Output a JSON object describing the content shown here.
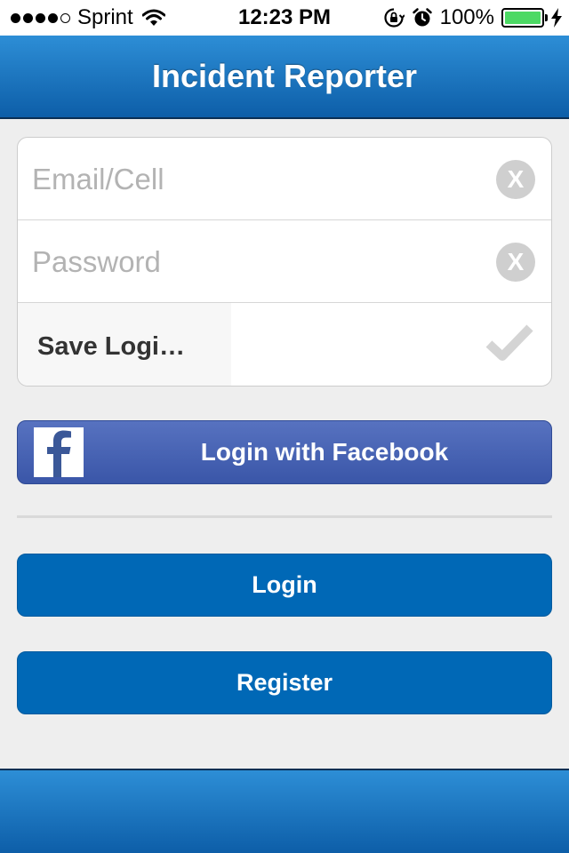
{
  "status_bar": {
    "carrier": "Sprint",
    "time": "12:23 PM",
    "battery_percent": "100%",
    "battery_level": 1.0,
    "signal_bars_filled": 4,
    "signal_bars_total": 5,
    "icons": [
      "wifi-icon",
      "orientation-lock-icon",
      "alarm-icon",
      "battery-icon",
      "charging-bolt-icon"
    ]
  },
  "nav": {
    "title": "Incident Reporter"
  },
  "form": {
    "email_placeholder": "Email/Cell",
    "email_value": "",
    "password_placeholder": "Password",
    "password_value": "",
    "clear_glyph": "X",
    "save_login_label": "Save Logi…",
    "save_login_checked": true
  },
  "buttons": {
    "facebook_label": "Login with Facebook",
    "login_label": "Login",
    "register_label": "Register"
  },
  "colors": {
    "nav_blue": "#1a73c2",
    "button_blue": "#0068b6",
    "facebook_blue": "#4862b4",
    "battery_green": "#4cd964",
    "background": "#eeeeee"
  }
}
